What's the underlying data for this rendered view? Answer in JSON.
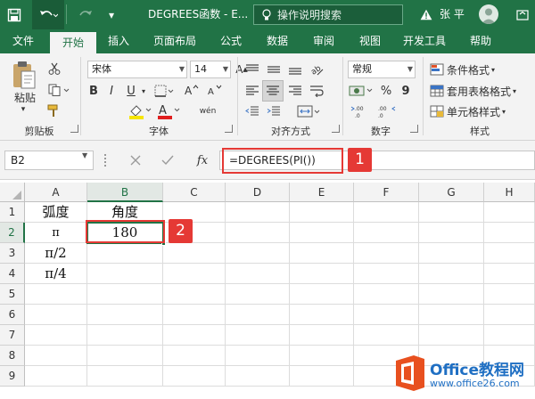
{
  "title_bar": {
    "doc_title": "DEGREES函数 - E...",
    "search_placeholder": "操作说明搜索",
    "user_name": "张 平"
  },
  "menu": {
    "tabs": [
      "文件",
      "开始",
      "插入",
      "页面布局",
      "公式",
      "数据",
      "审阅",
      "视图",
      "开发工具",
      "帮助"
    ],
    "active_tab": "开始"
  },
  "ribbon": {
    "clipboard": {
      "paste_label": "粘贴",
      "group_label": "剪贴板"
    },
    "font": {
      "font_name": "宋体",
      "font_size": "14",
      "bold": "B",
      "italic": "I",
      "underline": "U",
      "phonetic": "wén",
      "group_label": "字体"
    },
    "alignment": {
      "group_label": "对齐方式"
    },
    "number": {
      "format": "常规",
      "percent": "%",
      "comma": "9",
      "group_label": "数字"
    },
    "styles": {
      "conditional": "条件格式",
      "table_style": "套用表格格式",
      "cell_style": "单元格样式",
      "group_label": "样式"
    }
  },
  "formula_bar": {
    "name_box": "B2",
    "fx": "fx",
    "formula": "=DEGREES(PI())"
  },
  "annotations": {
    "badge1": "1",
    "badge2": "2"
  },
  "sheet": {
    "columns": [
      "A",
      "B",
      "C",
      "D",
      "E",
      "F",
      "G",
      "H"
    ],
    "rows": [
      "1",
      "2",
      "3",
      "4",
      "5",
      "6",
      "7",
      "8",
      "9"
    ],
    "cells": {
      "A1": "弧度",
      "B1": "角度",
      "A2": "π",
      "B2": "180",
      "A3": "π/2",
      "A4": "π/4"
    }
  },
  "watermark": {
    "brand": "Office教程网",
    "url": "www.office26.com"
  },
  "colors": {
    "excel_green": "#217346",
    "highlight_red": "#e53935",
    "office_orange": "#e8501f"
  }
}
